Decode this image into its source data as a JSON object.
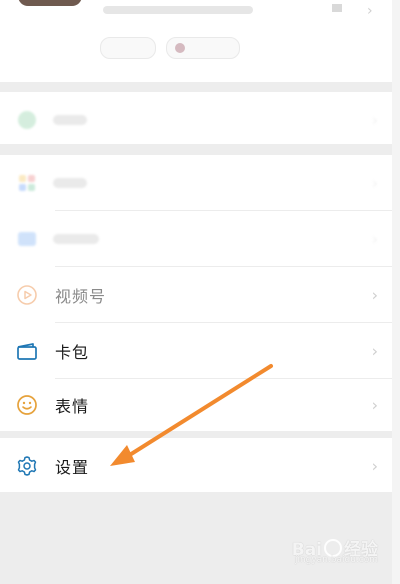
{
  "menu": {
    "items": [
      {
        "label": "服务",
        "icon": "services-icon",
        "visible": false
      },
      {
        "label": "收藏",
        "icon": "favorites-icon",
        "visible": false
      },
      {
        "label": "朋友圈",
        "icon": "moments-icon",
        "visible": false
      },
      {
        "label": "视频号",
        "icon": "channels-icon",
        "visible": true
      },
      {
        "label": "卡包",
        "icon": "cards-icon",
        "visible": true
      },
      {
        "label": "表情",
        "icon": "sticker-icon",
        "visible": true
      },
      {
        "label": "设置",
        "icon": "settings-icon",
        "visible": true
      }
    ]
  },
  "colors": {
    "accent_arrow": "#f28a2e",
    "icon_blue": "#1f77b4",
    "icon_yellow": "#e6a23c",
    "icon_orange": "#f0a46a"
  },
  "watermark": {
    "brand": "Bai",
    "suffix": "经验",
    "sub": "jingyan.baidu.com"
  }
}
